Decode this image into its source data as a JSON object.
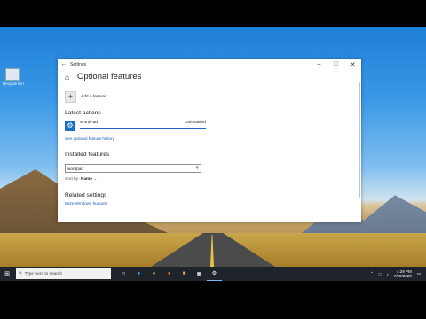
{
  "desktop": {
    "icon_label": "Recycle Bin"
  },
  "window": {
    "title": "Settings",
    "page_title": "Optional features",
    "add_feature_label": "Add a feature",
    "latest_actions_title": "Latest actions",
    "action_name": "WordPad",
    "action_status": "Uninstalled",
    "history_link": "See optional feature history",
    "installed_title": "Installed features",
    "search_value": "wordpad",
    "sort_label": "Sort by:",
    "sort_value": "Name",
    "related_title": "Related settings",
    "related_link": "More Windows features"
  },
  "taskbar": {
    "search_placeholder": "Type here to search",
    "time": "4:29 PM",
    "date": "7/20/2020"
  },
  "icons": {
    "back": "back-arrow-icon",
    "home": "home-icon",
    "minimize": "minimize-icon",
    "maximize": "maximize-icon",
    "close": "close-icon",
    "add": "plus-icon",
    "feature": "gear-icon",
    "search": "search-icon",
    "start": "windows-start-icon"
  },
  "colors": {
    "accent": "#1a6fc7",
    "link": "#1a5fb4",
    "taskbar": "#1f242b"
  }
}
